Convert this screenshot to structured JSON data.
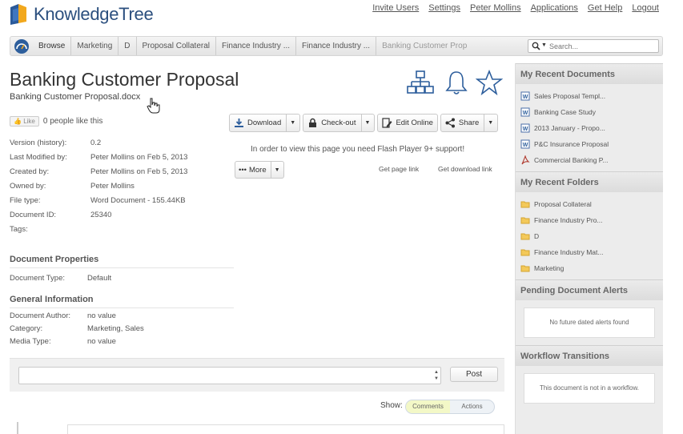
{
  "app": {
    "name": "KnowledgeTree",
    "brand_color": "#2b4f7e"
  },
  "header": {
    "links": [
      "Invite Users",
      "Settings",
      "Peter Mollins",
      "Applications",
      "Get Help",
      "Logout"
    ]
  },
  "breadcrumb": {
    "items": [
      "Browse",
      "Marketing",
      "D",
      "Proposal Collateral",
      "Finance Industry ...",
      "Finance Industry ...",
      "Banking Customer Prop"
    ]
  },
  "search": {
    "placeholder": "Search..."
  },
  "document": {
    "title": "Banking Customer Proposal",
    "filename": "Banking Customer Proposal.docx",
    "like_label": "Like",
    "like_count_text": "0 people like this",
    "metadata": [
      {
        "label": "Version (history):",
        "value": "0.2"
      },
      {
        "label": "Last Modified by:",
        "value": "Peter Mollins on Feb 5, 2013"
      },
      {
        "label": "Created by:",
        "value": "Peter Mollins on Feb 5, 2013"
      },
      {
        "label": "Owned by:",
        "value": "Peter Mollins"
      },
      {
        "label": "File type:",
        "value": "Word Document - 155.44KB"
      },
      {
        "label": "Document ID:",
        "value": "25340"
      },
      {
        "label": "Tags:",
        "value": ""
      }
    ],
    "properties_heading": "Document Properties",
    "properties": [
      {
        "label": "Document Type:",
        "value": "Default"
      }
    ],
    "general_heading": "General Information",
    "general": [
      {
        "label": "Document Author:",
        "value": "no value"
      },
      {
        "label": "Category:",
        "value": "Marketing, Sales"
      },
      {
        "label": "Media Type:",
        "value": "no value"
      }
    ]
  },
  "toolbar": {
    "download": "Download",
    "checkout": "Check-out",
    "edit_online": "Edit Online",
    "share": "Share",
    "more": "More"
  },
  "viewer": {
    "flash_message": "In order to view this page you need Flash Player 9+ support!",
    "get_page_link": "Get page link",
    "get_download_link": "Get download link"
  },
  "comments": {
    "post_label": "Post",
    "show_label": "Show:",
    "toggle": [
      "Comments",
      "Actions"
    ]
  },
  "sidebar": {
    "recent_docs_heading": "My Recent Documents",
    "recent_docs": [
      {
        "name": "Sales Proposal Templ...",
        "icon": "word-doc-icon"
      },
      {
        "name": "Banking Case Study",
        "icon": "word-doc-icon"
      },
      {
        "name": "2013 January - Propo...",
        "icon": "word-doc-icon"
      },
      {
        "name": "P&C Insurance Proposal",
        "icon": "word-doc-icon"
      },
      {
        "name": "Commercial Banking P...",
        "icon": "pdf-icon"
      }
    ],
    "recent_folders_heading": "My Recent Folders",
    "recent_folders": [
      {
        "name": "Proposal Collateral"
      },
      {
        "name": "Finance Industry Pro..."
      },
      {
        "name": "D"
      },
      {
        "name": "Finance Industry Mat..."
      },
      {
        "name": "Marketing"
      }
    ],
    "alerts_heading": "Pending Document Alerts",
    "alerts_empty": "No future dated alerts found",
    "workflow_heading": "Workflow Transitions",
    "workflow_empty": "This document is not in a workflow."
  }
}
